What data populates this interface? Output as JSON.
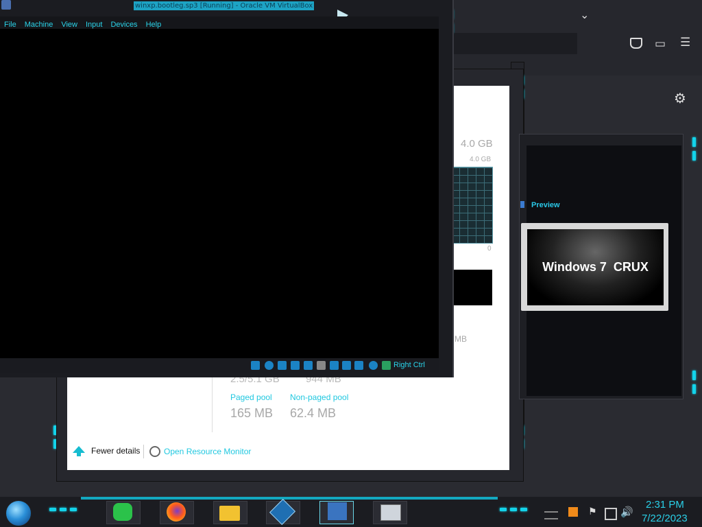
{
  "vbox": {
    "title": "winxp.bootleg.sp3 [Running] - Oracle VM VirtualBox",
    "menu": [
      "File",
      "Machine",
      "View",
      "Input",
      "Devices",
      "Help"
    ],
    "host_key": "Right Ctrl"
  },
  "taskmgr": {
    "mem_total": "4.0 GB",
    "graph_max": "4.0 GB",
    "graph_min": "0",
    "mb_partial": "MB",
    "committed_partial": "2.5/5.1 GB",
    "cached_partial": "944 MB",
    "paged_pool_label": "Paged pool",
    "paged_pool_value": "165 MB",
    "nonpaged_pool_label": "Non-paged pool",
    "nonpaged_pool_value": "62.4 MB",
    "fewer_details": "Fewer details",
    "resource_monitor": "Open Resource Monitor"
  },
  "preview": {
    "label": "Preview",
    "thumb_text": "Windows 7  CRUX"
  },
  "tray": {
    "time": "2:31 PM",
    "date": "7/22/2023"
  },
  "taskbar_apps": [
    "start-orb",
    "notes-app",
    "firefox",
    "file-explorer",
    "virtualbox",
    "winxp-vm",
    "system-monitor"
  ]
}
